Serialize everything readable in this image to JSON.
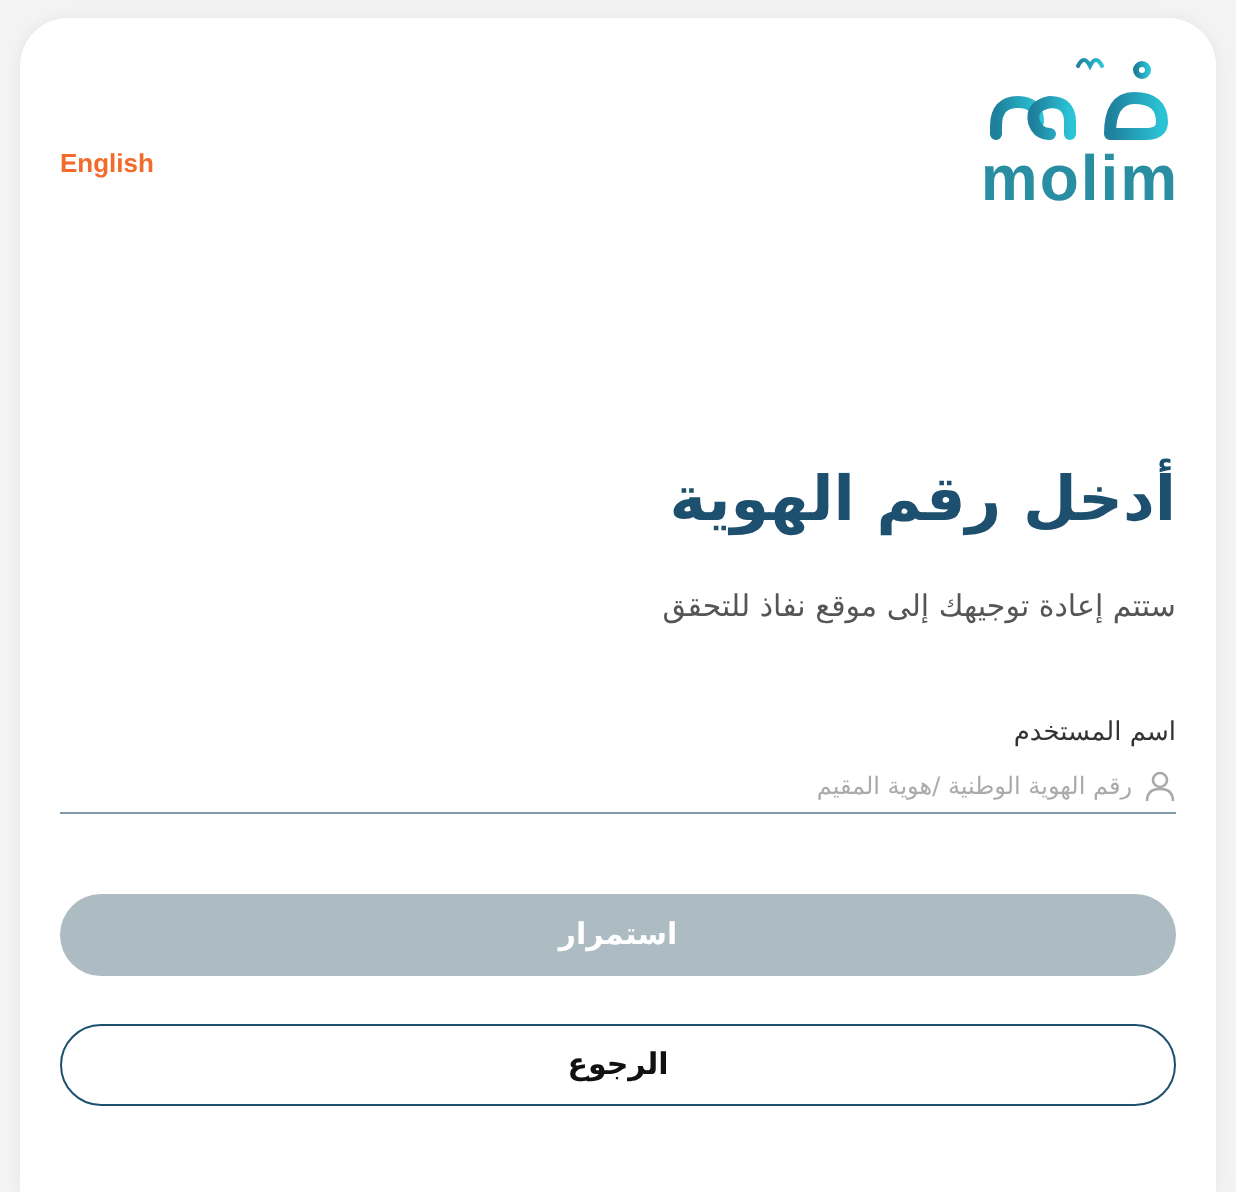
{
  "language_link": "English",
  "logo": {
    "wordmark": "molim"
  },
  "title": "أدخل رقم الهوية",
  "subtitle": "ستتم إعادة توجيهك إلى موقع نفاذ للتحقق",
  "username_field": {
    "label": "اسم المستخدم",
    "placeholder": "رقم الهوية الوطنية /هوية المقيم"
  },
  "buttons": [
    {
      "kind": "primary",
      "label": "استمرار",
      "disabled": true
    },
    {
      "kind": "outline",
      "label": "الرجوع",
      "disabled": false
    }
  ]
}
